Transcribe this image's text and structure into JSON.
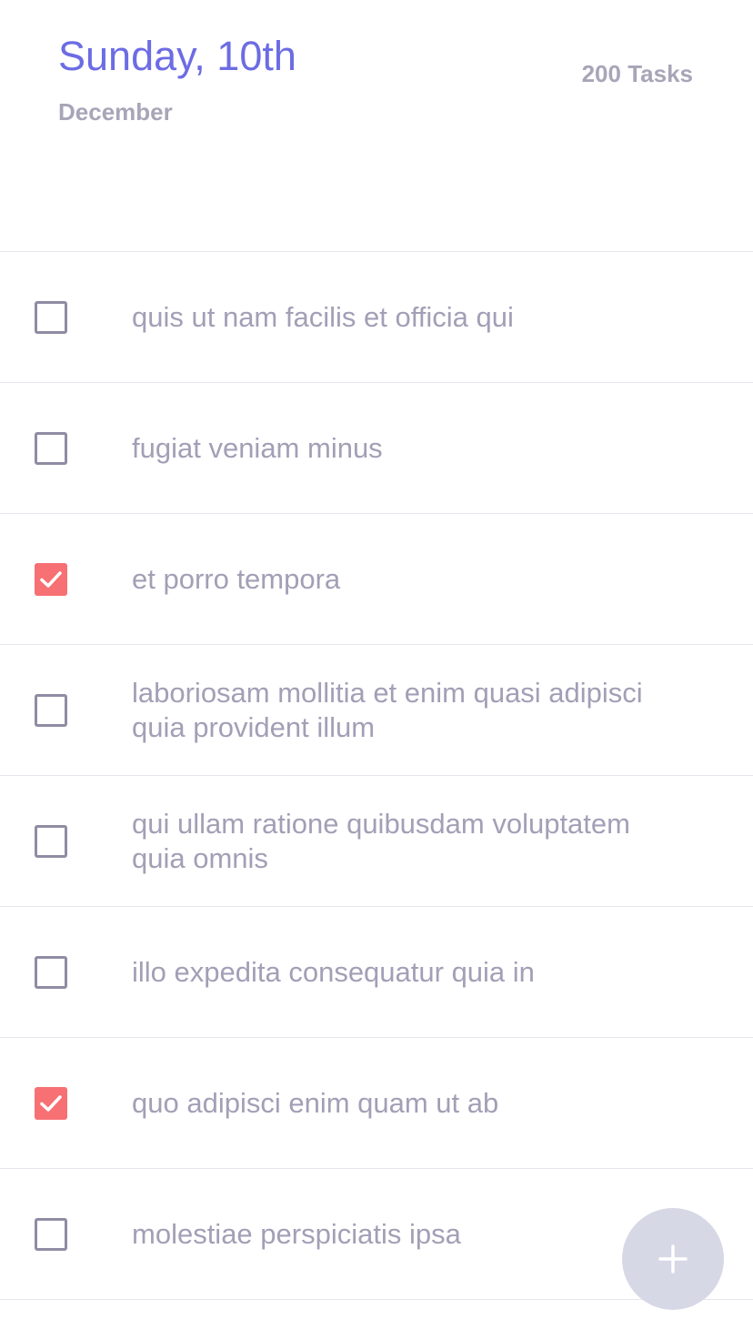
{
  "header": {
    "title": "Sunday, 10th",
    "month": "December",
    "task_count": "200 Tasks"
  },
  "colors": {
    "accent": "#6c6ce4",
    "checked": "#f77073",
    "muted_text": "#a29fb6",
    "fab": "#d7d8e6"
  },
  "tasks": [
    {
      "text": "quis ut nam facilis et officia qui",
      "completed": false
    },
    {
      "text": "fugiat veniam minus",
      "completed": false
    },
    {
      "text": "et porro tempora",
      "completed": true
    },
    {
      "text": "laboriosam mollitia et enim quasi adipisci quia provident illum",
      "completed": false
    },
    {
      "text": "qui ullam ratione quibusdam voluptatem quia omnis",
      "completed": false
    },
    {
      "text": "illo expedita consequatur quia in",
      "completed": false
    },
    {
      "text": "quo adipisci enim quam ut ab",
      "completed": true
    },
    {
      "text": "molestiae perspiciatis ipsa",
      "completed": false
    }
  ],
  "fab": {
    "icon": "plus-icon"
  }
}
